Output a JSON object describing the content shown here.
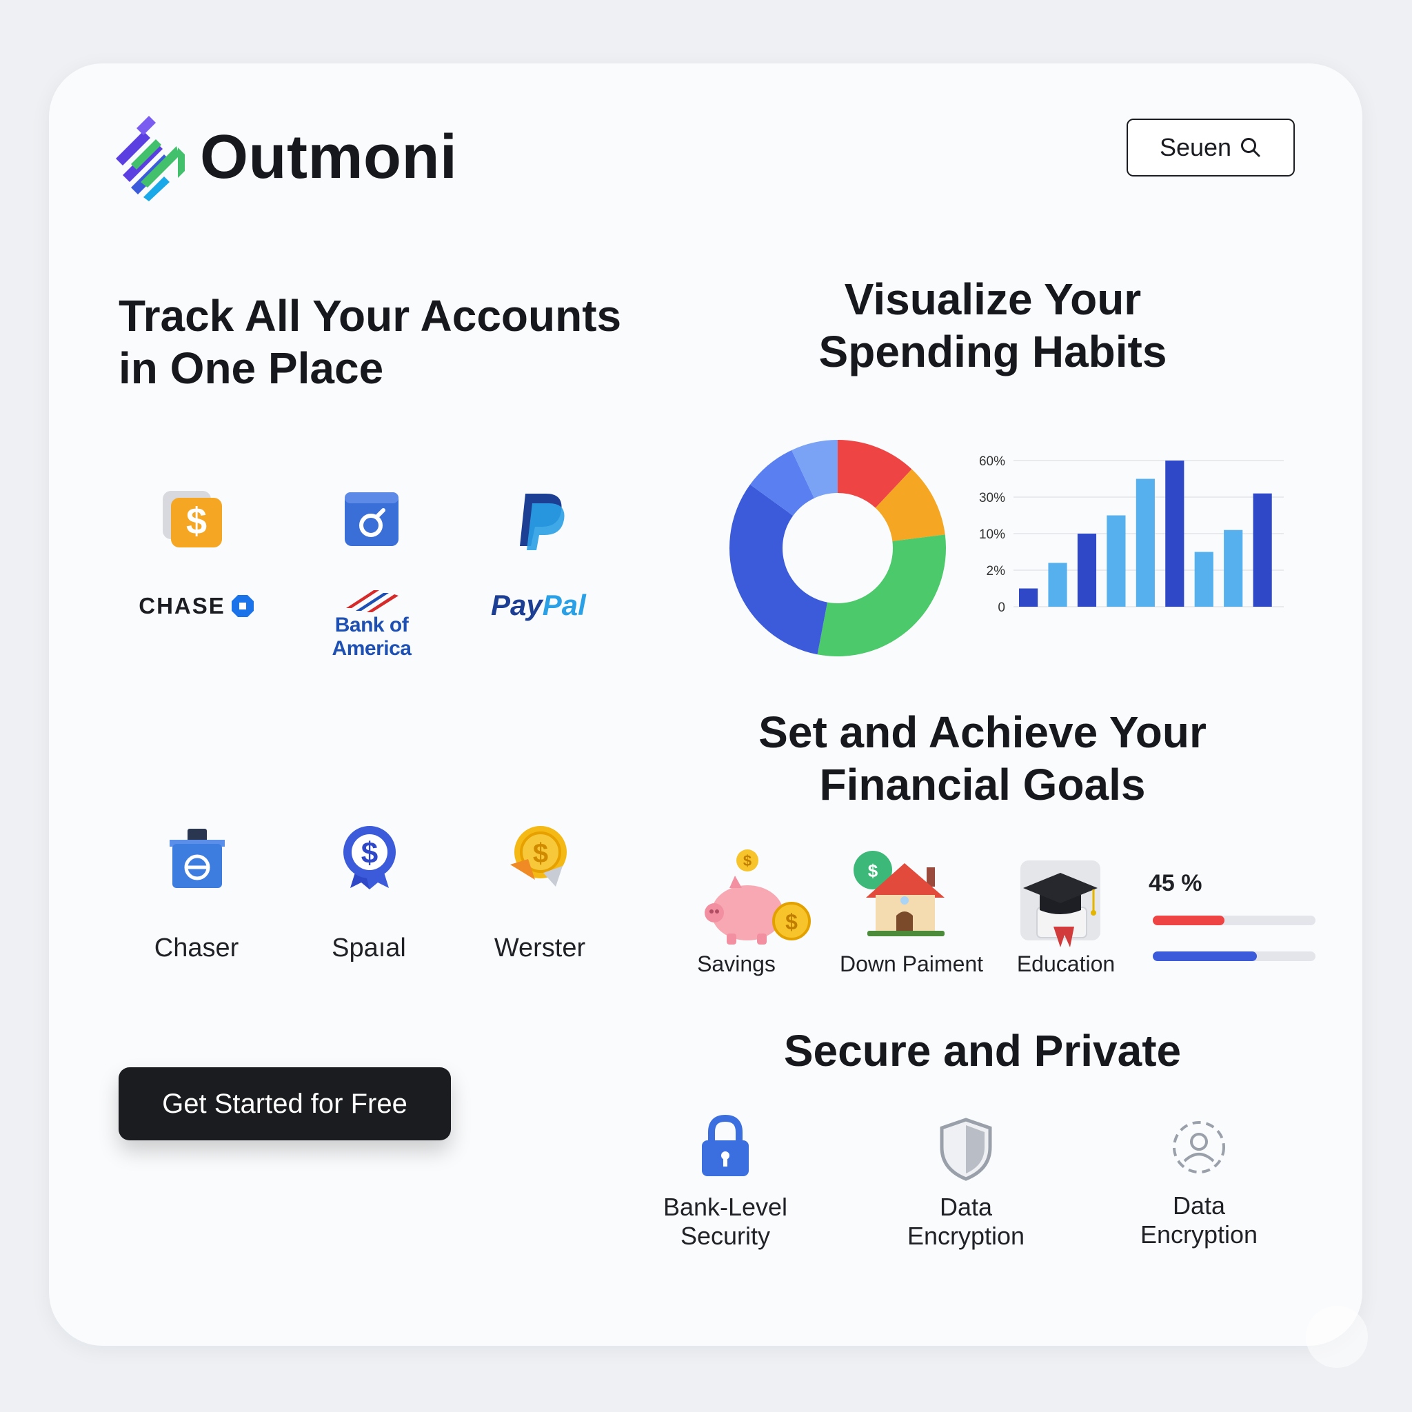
{
  "brand": {
    "name": "Outmoni"
  },
  "header": {
    "search_label": "Seuen"
  },
  "accounts": {
    "title": "Track All Your Accounts in One Place",
    "row1": [
      {
        "logo_text": "CHASE",
        "icon": "dollar-icon"
      },
      {
        "logo_text": "Bank of America",
        "icon": "bank-card-icon"
      },
      {
        "logo_text_pay": "Pay",
        "logo_text_pal": "Pal",
        "icon": "paypal-icon"
      }
    ],
    "row2": [
      {
        "label": "Chaser",
        "icon": "bank-building-icon"
      },
      {
        "label": "Spaıal",
        "icon": "dollar-badge-icon"
      },
      {
        "label": "Werster",
        "icon": "coin-icon"
      }
    ],
    "cta_label": "Get Started for Free"
  },
  "spending": {
    "title": "Visualize Your Spending Habits"
  },
  "chart_data": [
    {
      "type": "pie",
      "style": "donut",
      "slices": [
        {
          "value": 12,
          "color": "#ef4444"
        },
        {
          "value": 11,
          "color": "#f5a623"
        },
        {
          "value": 30,
          "color": "#4cc96b"
        },
        {
          "value": 32,
          "color": "#3b5bdb"
        },
        {
          "value": 8,
          "color": "#5a7ff0"
        },
        {
          "value": 7,
          "color": "#7aa2f5"
        }
      ]
    },
    {
      "type": "bar",
      "y_tick_labels": [
        "0",
        "2%",
        "10%",
        "30%",
        "60%"
      ],
      "grid": true,
      "values": [
        0.5,
        1.2,
        2.0,
        2.5,
        3.5,
        4.0,
        1.5,
        2.1,
        3.1
      ],
      "bar_colors": [
        "#2e48c8",
        "#56b0ee",
        "#2e48c8",
        "#56b0ee",
        "#56b0ee",
        "#2e48c8",
        "#56b0ee",
        "#56b0ee",
        "#2e48c8"
      ]
    }
  ],
  "goals": {
    "title": "Set and Achieve Your Financial Goals",
    "items": [
      {
        "label": "Savings",
        "icon": "piggy-bank-icon"
      },
      {
        "label": "Down Paiment",
        "icon": "house-icon"
      },
      {
        "label": "Education",
        "icon": "graduation-cap-icon"
      }
    ],
    "progress_label": "45 %",
    "progress": [
      {
        "value": 0.44,
        "color": "#ef4444"
      },
      {
        "value": 0.64,
        "color": "#3b5bdb"
      }
    ]
  },
  "security": {
    "title": "Secure and Private",
    "items": [
      {
        "label": "Bank-Level\nSecurity",
        "icon": "lock-icon"
      },
      {
        "label": "Data\nEncryption",
        "icon": "shield-icon"
      },
      {
        "label": "Data\nEncryption",
        "icon": "user-privacy-icon"
      }
    ]
  }
}
